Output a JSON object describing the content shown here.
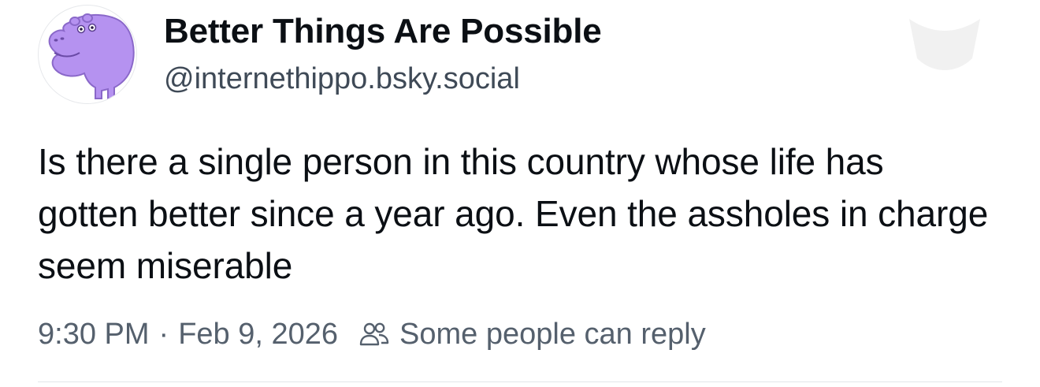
{
  "post": {
    "author": {
      "display_name": "Better Things Are Possible",
      "handle": "@internethippo.bsky.social",
      "avatar_icon": "purple-hippo-avatar"
    },
    "text": "Is there a single person in this country whose life has gotten better since a year ago. Even the assholes in charge seem miserable",
    "time": "9:30 PM",
    "separator": "·",
    "date": "Feb 9, 2026",
    "reply_setting_icon": "people-icon",
    "reply_setting": "Some people can reply"
  },
  "colors": {
    "avatar_purple": "#b592f0",
    "text_primary": "#0b0f14",
    "text_secondary": "#55606d"
  }
}
